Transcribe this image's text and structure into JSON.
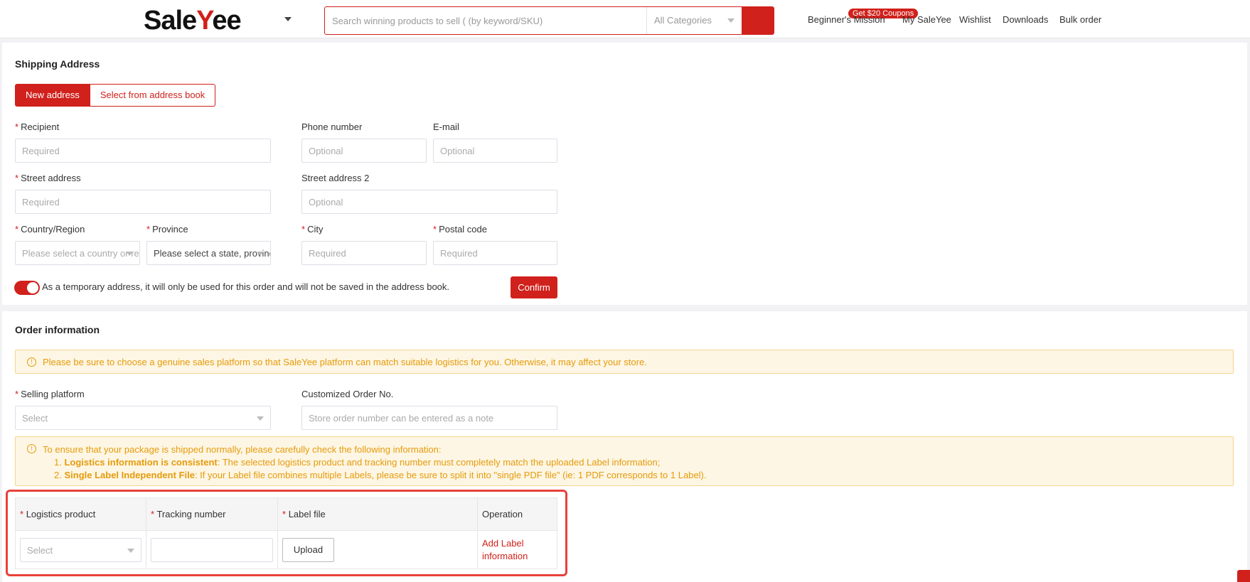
{
  "header": {
    "logo_prefix": "Sale",
    "logo_y": "Y",
    "logo_suffix": "ee",
    "search_placeholder": "Search winning products to sell ( (by keyword/SKU)",
    "category": "All Categories",
    "coupon_badge": "Get $20 Coupons",
    "nav": [
      "Beginner's Mission",
      "My SaleYee",
      "Wishlist",
      "Downloads",
      "Bulk order"
    ]
  },
  "shipping": {
    "title": "Shipping Address",
    "tab_new": "New address",
    "tab_book": "Select from address book",
    "recipient_label": "Recipient",
    "recipient_placeholder": "Required",
    "phone_label": "Phone number",
    "phone_placeholder": "Optional",
    "email_label": "E-mail",
    "email_placeholder": "Optional",
    "street_label": "Street address",
    "street_placeholder": "Required",
    "street2_label": "Street address 2",
    "street2_placeholder": "Optional",
    "country_label": "Country/Region",
    "country_placeholder": "Please select a country or region",
    "province_label": "Province",
    "province_placeholder": "Please select a state, province",
    "city_label": "City",
    "city_placeholder": "Required",
    "postal_label": "Postal code",
    "postal_placeholder": "Required",
    "temp_note": "As a temporary address, it will only be used for this order and will not be saved in the address book.",
    "confirm": "Confirm"
  },
  "order": {
    "title": "Order information",
    "notice": "Please be sure to choose a genuine sales platform so that SaleYee platform can match suitable logistics for you. Otherwise, it may affect your store.",
    "platform_label": "Selling platform",
    "platform_placeholder": "Select",
    "custom_no_label": "Customized Order No.",
    "custom_no_placeholder": "Store order number can be entered as a note",
    "check_intro": "To ensure that your package is shipped normally, please carefully check the following information:",
    "check_1_num": "1.",
    "check_1_bold": "Logistics information is consistent",
    "check_1_text": ": The selected logistics product and tracking number must completely match the uploaded Label information;",
    "check_2_num": "2.",
    "check_2_bold": "Single Label Independent File",
    "check_2_text": ": If your Label file combines multiple Labels, please be sure to split it into \"single PDF file\" (ie: 1 PDF corresponds to 1 Label).",
    "table": {
      "col_logistics": "Logistics product",
      "col_tracking": "Tracking number",
      "col_label": "Label file",
      "col_operation": "Operation",
      "select_placeholder": "Select",
      "upload": "Upload",
      "add_label": "Add Label information"
    }
  },
  "required_mark": "*",
  "warn_glyph": "!"
}
